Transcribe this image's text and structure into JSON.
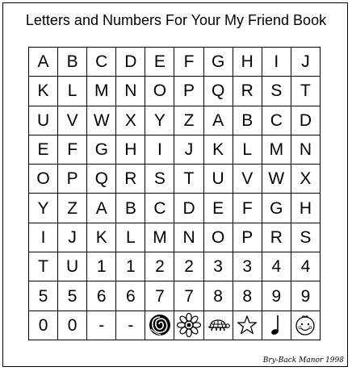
{
  "title": "Letters and Numbers For Your My Friend Book",
  "credit": "Bry-Back Manor 1998",
  "rows": [
    [
      "A",
      "B",
      "C",
      "D",
      "E",
      "F",
      "G",
      "H",
      "I",
      "J"
    ],
    [
      "K",
      "L",
      "M",
      "N",
      "O",
      "P",
      "Q",
      "R",
      "S",
      "T"
    ],
    [
      "U",
      "V",
      "W",
      "X",
      "Y",
      "Z",
      "A",
      "B",
      "C",
      "D"
    ],
    [
      "E",
      "F",
      "G",
      "H",
      "I",
      "J",
      "K",
      "L",
      "M",
      "N"
    ],
    [
      "O",
      "P",
      "Q",
      "R",
      "S",
      "T",
      "U",
      "V",
      "W",
      "X"
    ],
    [
      "Y",
      "Z",
      "A",
      "B",
      "C",
      "D",
      "E",
      "F",
      "G",
      "H"
    ],
    [
      "I",
      "J",
      "K",
      "L",
      "M",
      "N",
      "O",
      "P",
      "R",
      "S"
    ],
    [
      "T",
      "U",
      "1",
      "1",
      "2",
      "2",
      "3",
      "3",
      "4",
      "4"
    ],
    [
      "5",
      "5",
      "6",
      "6",
      "7",
      "7",
      "8",
      "8",
      "9",
      "9"
    ],
    [
      "0",
      "0",
      "-",
      "-"
    ]
  ],
  "icons": [
    "rose-icon",
    "daisy-icon",
    "turtle-icon",
    "star-icon",
    "music-note-icon",
    "smiley-face-icon"
  ]
}
